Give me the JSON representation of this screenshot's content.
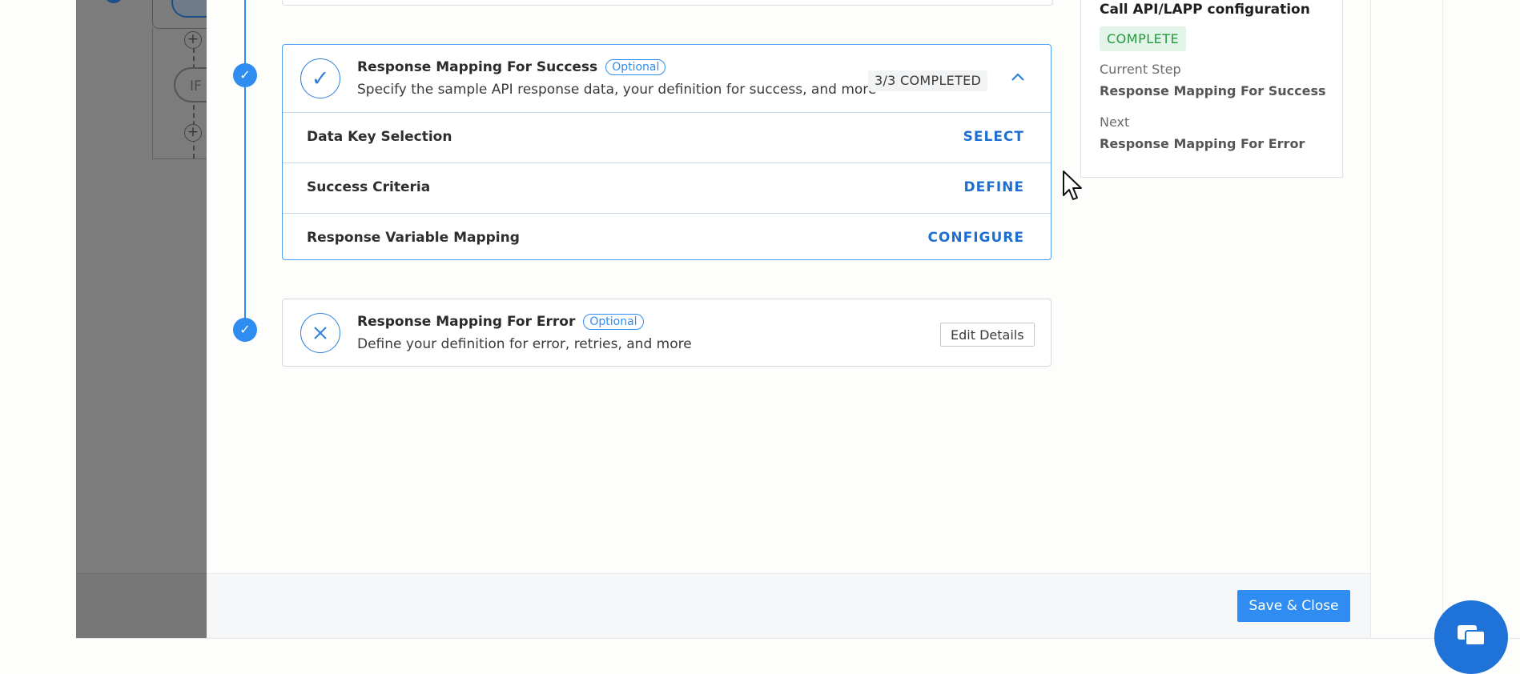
{
  "canvas": {
    "if_label": "IF"
  },
  "steps": {
    "success": {
      "title": "Response Mapping For Success",
      "optional_label": "Optional",
      "description": "Specify the sample API response data, your definition for success, and more",
      "progress": "3/3 COMPLETED",
      "status_icon": "check-icon",
      "rows": [
        {
          "label": "Data Key Selection",
          "action": "SELECT"
        },
        {
          "label": "Success Criteria",
          "action": "DEFINE"
        },
        {
          "label": "Response Variable Mapping",
          "action": "CONFIGURE"
        }
      ]
    },
    "error": {
      "title": "Response Mapping For Error",
      "optional_label": "Optional",
      "description": "Define your definition for error, retries, and more",
      "edit_label": "Edit Details",
      "status_icon": "close-icon"
    }
  },
  "summary": {
    "title": "Call API/LAPP configuration",
    "status": "COMPLETE",
    "current_step_label": "Current Step",
    "current_step_value": "Response Mapping For Success",
    "next_label": "Next",
    "next_value": "Response Mapping For Error"
  },
  "footer": {
    "save_label": "Save & Close"
  },
  "colors": {
    "accent": "#2f8cf0",
    "complete_bg": "#e3f4e8",
    "complete_text": "#1f9b3e"
  }
}
